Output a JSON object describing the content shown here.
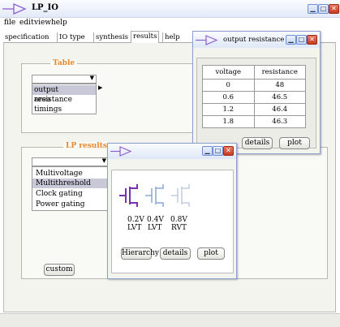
{
  "main_window": {
    "title": "LP_IO",
    "menu": [
      "file",
      "edit",
      "view",
      "help"
    ],
    "tabs": [
      "specification",
      "IO type",
      "synthesis",
      "results",
      "help"
    ],
    "active_tab": "results"
  },
  "table_panel": {
    "legend": "Table",
    "items": [
      "output resistance",
      "area",
      "timings"
    ],
    "selected_item": "output resistance"
  },
  "lp_panel": {
    "legend": "LP results",
    "items": [
      "Multivoltage",
      "Multithreshold",
      "Clock gating",
      "Power gating"
    ],
    "selected_item": "Multithreshold",
    "custom_button": "custom"
  },
  "resistance_window": {
    "title": "output resistance",
    "columns": [
      "voltage",
      "resistance"
    ],
    "rows": [
      [
        "0",
        "48"
      ],
      [
        "0.6",
        "46.5"
      ],
      [
        "1.2",
        "46.4"
      ],
      [
        "1.8",
        "46.3"
      ]
    ],
    "details_button": "details",
    "plot_button": "plot"
  },
  "threshold_window": {
    "transistors": [
      {
        "voltage": "0.2V",
        "type": "LVT",
        "color": "#7a2fb0"
      },
      {
        "voltage": "0.4V",
        "type": "LVT",
        "color": "#8aa6d8"
      },
      {
        "voltage": "0.8V",
        "type": "RVT",
        "color": "#b8c4dc"
      }
    ],
    "hierarchy_button": "Hierarchy",
    "details_button": "details",
    "plot_button": "plot"
  },
  "colors": {
    "titlebar": "#d6dff5",
    "accent_arrow": "#8f5fd0",
    "legend": "#e8882c",
    "selection": "#c8c8d8"
  }
}
